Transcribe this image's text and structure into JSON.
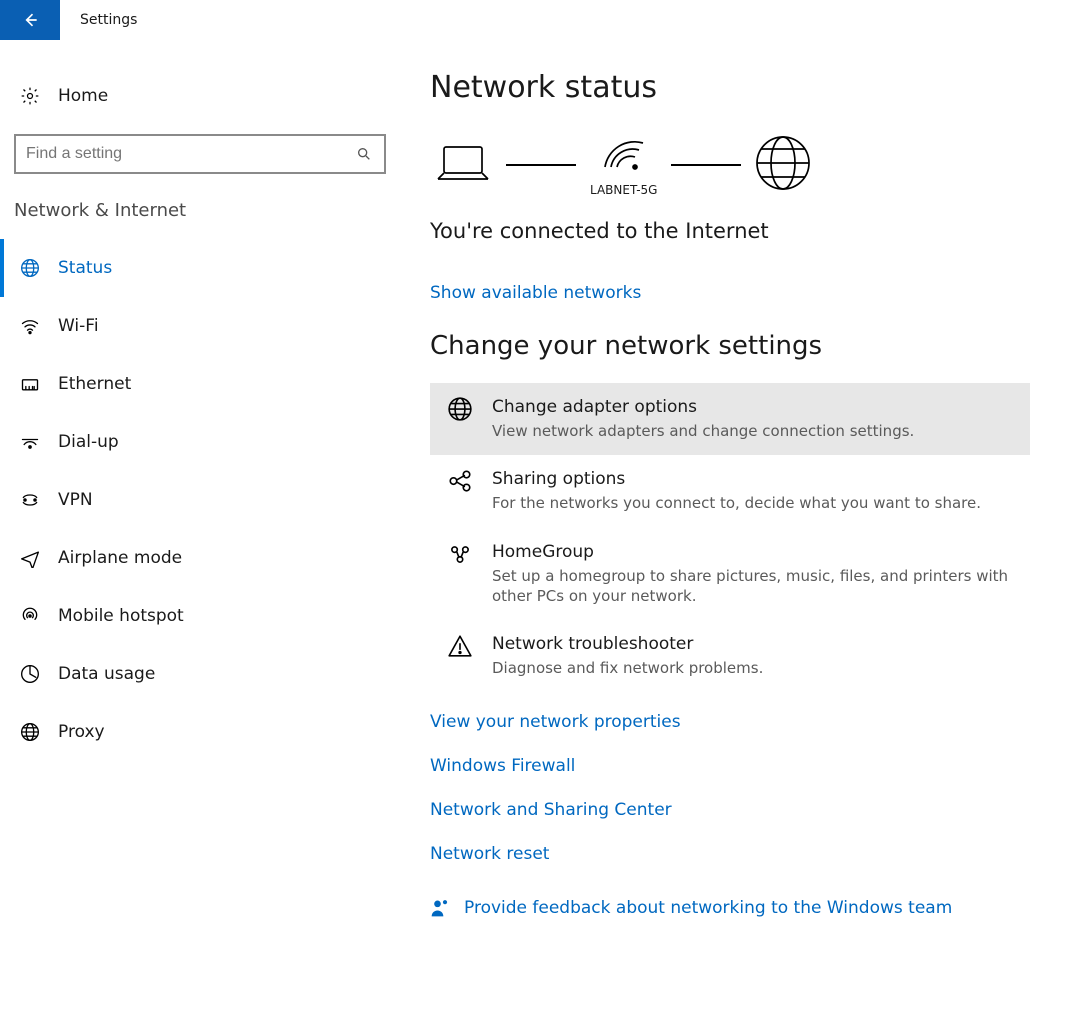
{
  "titlebar": {
    "title": "Settings"
  },
  "leftPane": {
    "homeLabel": "Home",
    "searchPlaceholder": "Find a setting",
    "sectionHeader": "Network & Internet",
    "items": [
      {
        "label": "Status",
        "icon": "globe-icon",
        "active": true
      },
      {
        "label": "Wi-Fi",
        "icon": "wifi-icon",
        "active": false
      },
      {
        "label": "Ethernet",
        "icon": "ethernet-icon",
        "active": false
      },
      {
        "label": "Dial-up",
        "icon": "dialup-icon",
        "active": false
      },
      {
        "label": "VPN",
        "icon": "vpn-icon",
        "active": false
      },
      {
        "label": "Airplane mode",
        "icon": "airplane-icon",
        "active": false
      },
      {
        "label": "Mobile hotspot",
        "icon": "hotspot-icon",
        "active": false
      },
      {
        "label": "Data usage",
        "icon": "datausage-icon",
        "active": false
      },
      {
        "label": "Proxy",
        "icon": "globe-icon",
        "active": false
      }
    ]
  },
  "rightPane": {
    "pageTitle": "Network status",
    "networkName": "LABNET-5G",
    "connectedMessage": "You're connected to the Internet",
    "showNetworksLink": "Show available networks",
    "subheading": "Change your network settings",
    "cards": [
      {
        "title": "Change adapter options",
        "desc": "View network adapters and change connection settings.",
        "icon": "globe-icon",
        "hover": true
      },
      {
        "title": "Sharing options",
        "desc": "For the networks you connect to, decide what you want to share.",
        "icon": "share-icon",
        "hover": false
      },
      {
        "title": "HomeGroup",
        "desc": "Set up a homegroup to share pictures, music, files, and printers with other PCs on your network.",
        "icon": "homegroup-icon",
        "hover": false
      },
      {
        "title": "Network troubleshooter",
        "desc": "Diagnose and fix network problems.",
        "icon": "warning-icon",
        "hover": false
      }
    ],
    "links": [
      "View your network properties",
      "Windows Firewall",
      "Network and Sharing Center",
      "Network reset"
    ],
    "feedbackLink": "Provide feedback about networking to the Windows team"
  }
}
